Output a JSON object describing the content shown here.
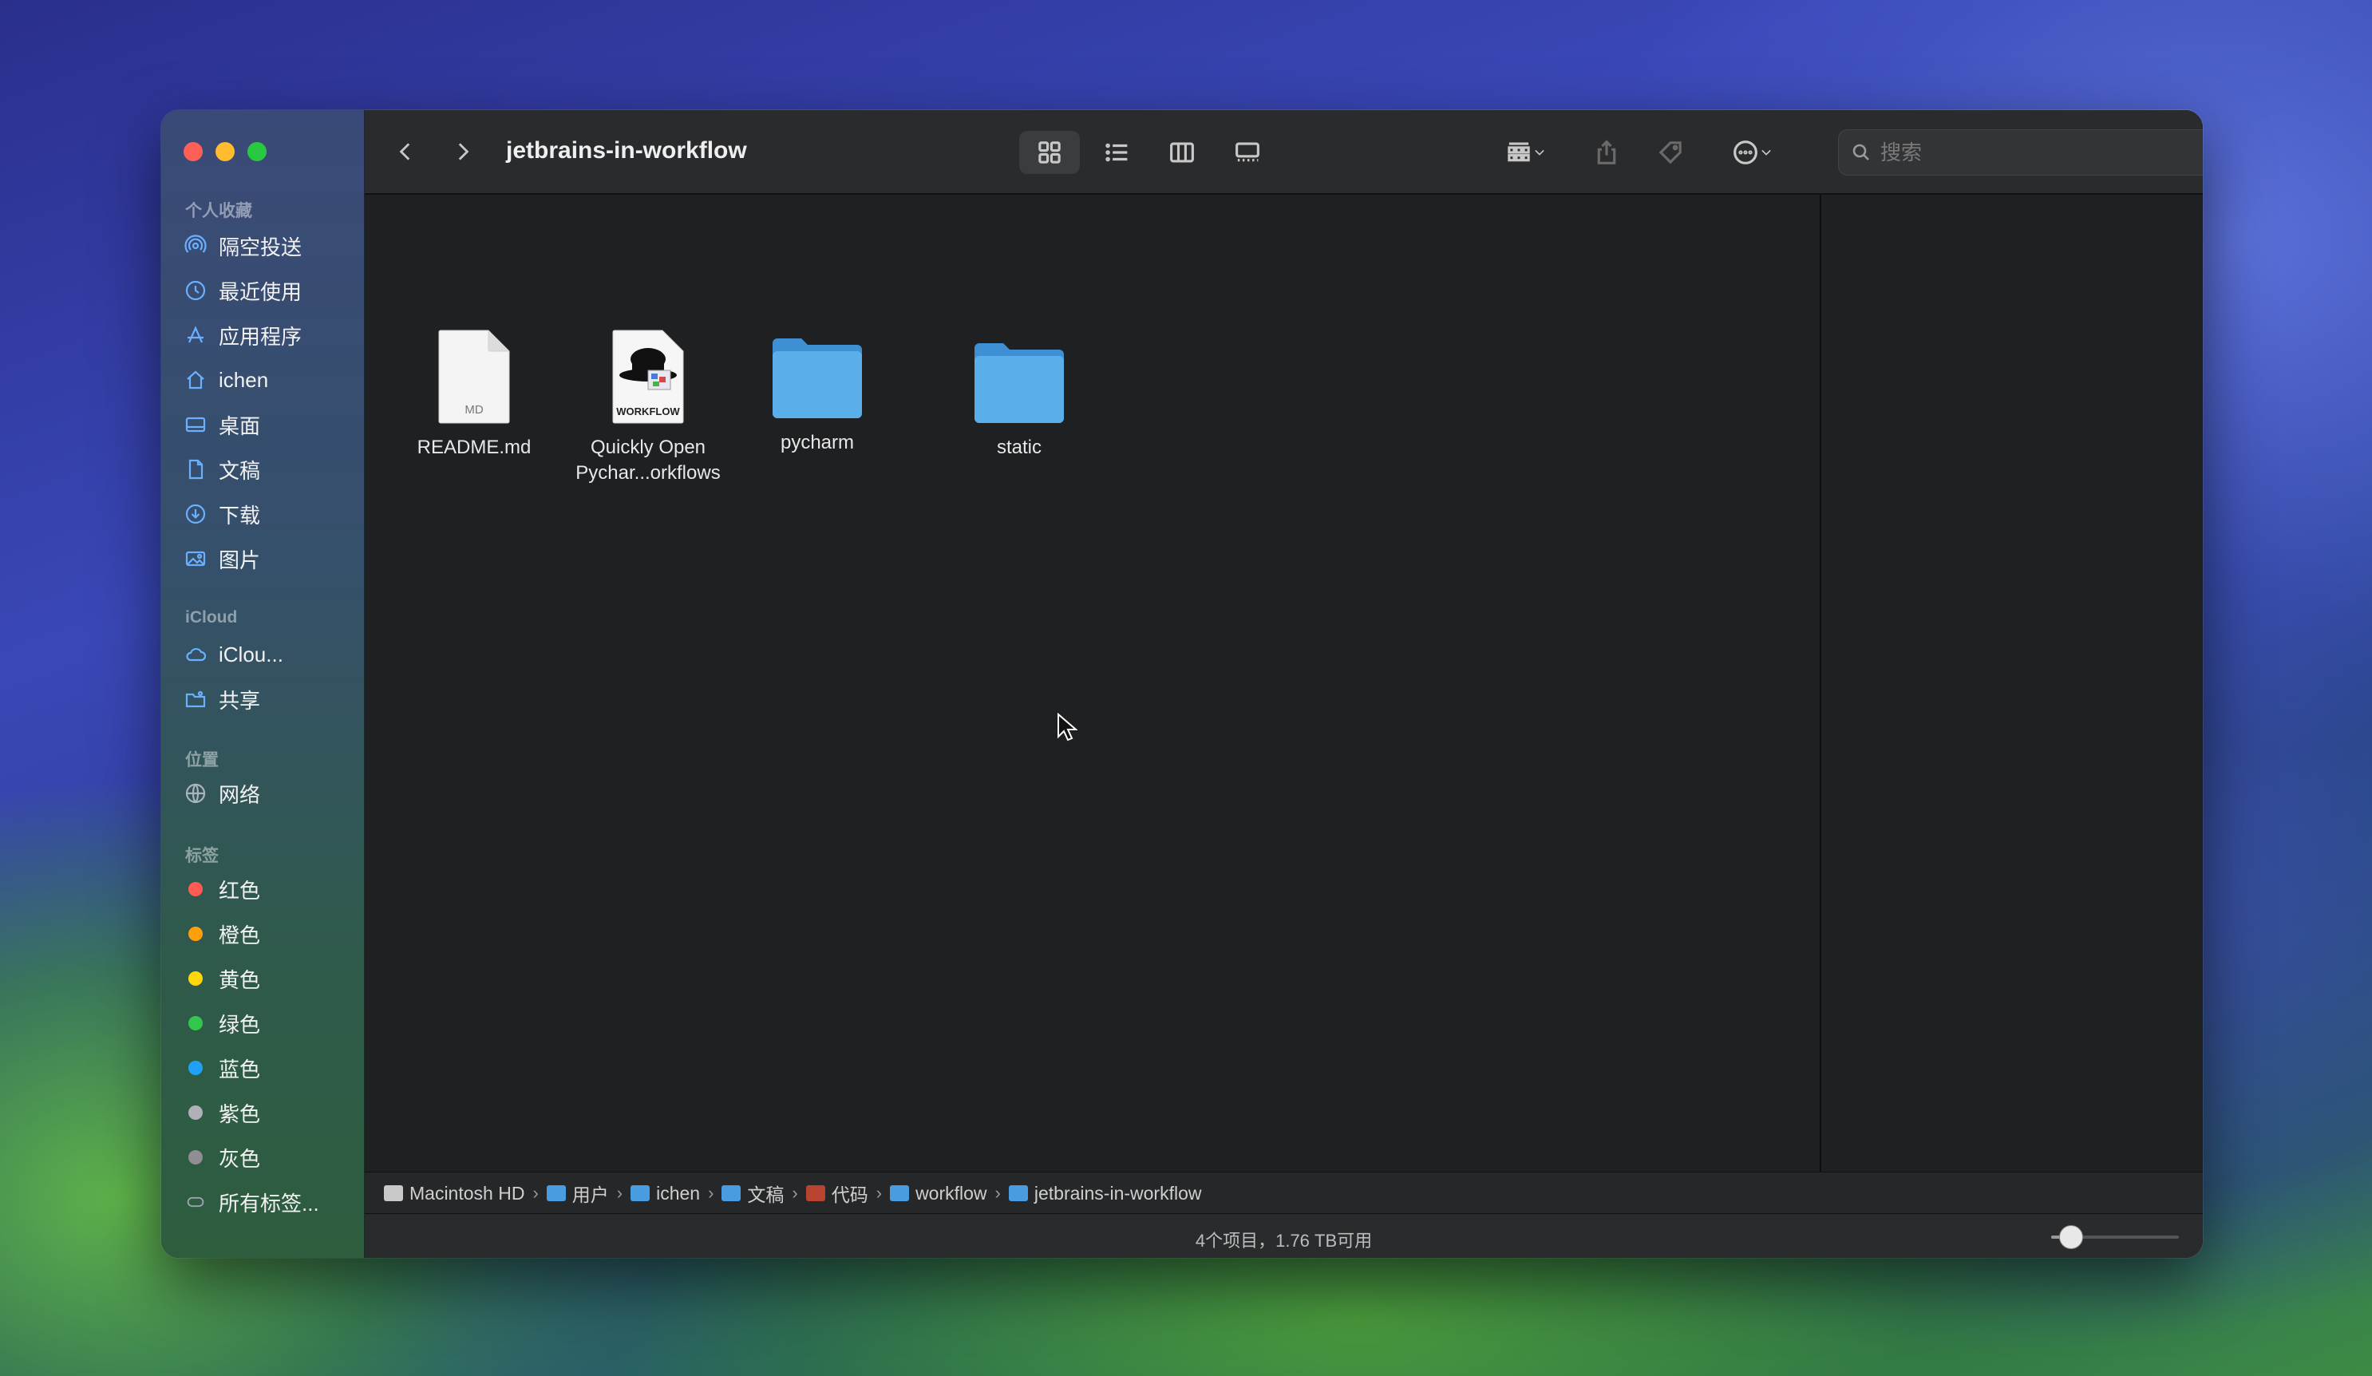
{
  "window": {
    "title": "jetbrains-in-workflow",
    "search_placeholder": "搜索"
  },
  "sidebar": {
    "favorites_header": "个人收藏",
    "favorites": [
      {
        "label": "隔空投送",
        "icon": "airdrop-icon"
      },
      {
        "label": "最近使用",
        "icon": "clock-icon"
      },
      {
        "label": "应用程序",
        "icon": "applications-icon"
      },
      {
        "label": "ichen",
        "icon": "home-icon"
      },
      {
        "label": "桌面",
        "icon": "desktop-icon"
      },
      {
        "label": "文稿",
        "icon": "document-icon"
      },
      {
        "label": "下载",
        "icon": "download-icon"
      },
      {
        "label": "图片",
        "icon": "photo-icon"
      }
    ],
    "icloud_header": "iCloud",
    "icloud": [
      {
        "label": "iClou...",
        "icon": "cloud-icon"
      },
      {
        "label": "共享",
        "icon": "shared-folder-icon"
      }
    ],
    "locations_header": "位置",
    "locations": [
      {
        "label": "网络",
        "icon": "network-icon"
      }
    ],
    "tags_header": "标签",
    "tags": [
      {
        "label": "红色",
        "color": "#ff5b53"
      },
      {
        "label": "橙色",
        "color": "#ff9f0a"
      },
      {
        "label": "黄色",
        "color": "#ffd60a"
      },
      {
        "label": "绿色",
        "color": "#32c74c"
      },
      {
        "label": "蓝色",
        "color": "#1fa1f5"
      },
      {
        "label": "紫色",
        "color": "#b0b0b6"
      },
      {
        "label": "灰色",
        "color": "#8e8e93"
      },
      {
        "label": "所有标签...",
        "color": ""
      }
    ]
  },
  "files": [
    {
      "name": "README.md",
      "kind": "markdown-document",
      "badge": "MD"
    },
    {
      "name_line1": "Quickly Open",
      "name_line2": "Pychar...orkflows",
      "kind": "alfred-workflow",
      "badge": "WORKFLOW"
    },
    {
      "name": "pycharm",
      "kind": "folder"
    },
    {
      "name": "static",
      "kind": "folder"
    }
  ],
  "pathbar": [
    {
      "label": "Macintosh HD",
      "icon": "hard-drive-icon"
    },
    {
      "label": "用户",
      "icon": "folder-icon"
    },
    {
      "label": "ichen",
      "icon": "home-folder-icon"
    },
    {
      "label": "文稿",
      "icon": "folder-icon"
    },
    {
      "label": "代码",
      "icon": "folder-icon-red"
    },
    {
      "label": "workflow",
      "icon": "folder-icon"
    },
    {
      "label": "jetbrains-in-workflow",
      "icon": "folder-icon"
    }
  ],
  "status": {
    "text": "4个项目，1.76 TB可用",
    "icon_size_level": 0.15
  },
  "colors": {
    "folder_blue": "#5aaeea",
    "accent": "#6ab0ff"
  }
}
